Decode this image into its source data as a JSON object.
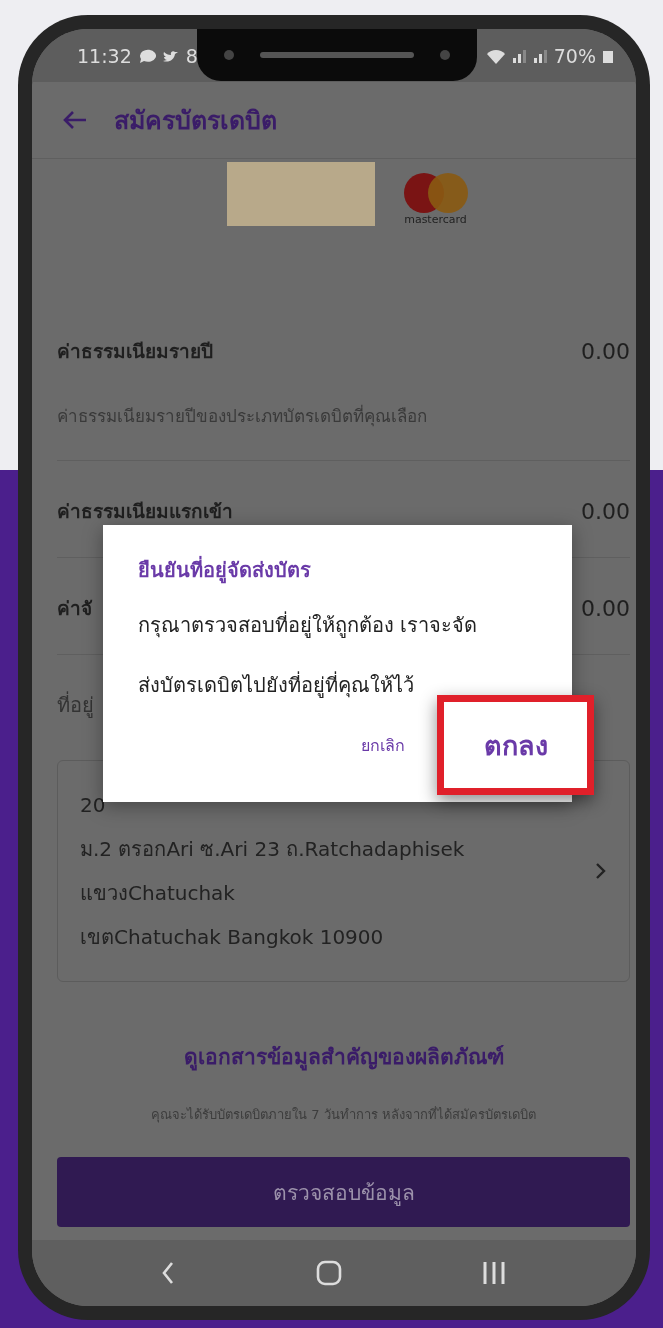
{
  "status_bar": {
    "time": "11:32",
    "notification_count": "8",
    "battery": "70%"
  },
  "header": {
    "title": "สมัครบัตรเดบิต"
  },
  "card_preview": {
    "brand_label": "mastercard"
  },
  "fees": [
    {
      "label": "ค่าธรรมเนียมรายปี",
      "value": "0.00",
      "description": "ค่าธรรมเนียมรายปีของประเภทบัตรเดบิตที่คุณเลือก"
    },
    {
      "label": "ค่าธรรมเนียมแรกเข้า",
      "value": "0.00"
    },
    {
      "label": "ค่าจั",
      "value": "0.00"
    }
  ],
  "address": {
    "label": "ที่อยู่",
    "lines": [
      "20",
      "ม.2 ตรอกAri ซ.Ari 23 ถ.Ratchadaphisek",
      "แขวงChatuchak",
      "เขตChatuchak Bangkok 10900"
    ]
  },
  "document_link": "ดูเอกสารข้อมูลสำคัญของผลิตภัณฑ์",
  "note": "คุณจะได้รับบัตรเดบิตภายใน 7 วันทำการ หลังจากที่ได้สมัครบัตรเดบิต",
  "submit_button": "ตรวจสอบข้อมูล",
  "dialog": {
    "title": "ยืนยันที่อยู่จัดส่งบัตร",
    "message": "กรุณาตรวจสอบที่อยู่ให้ถูกต้อง เราจะจัดส่งบัตรเดบิตไปยังที่อยู่ที่คุณให้ไว้",
    "buttons": [
      {
        "label": "ยกเลิก",
        "highlighted": false
      },
      {
        "label": "ตกลง",
        "highlighted": true
      }
    ]
  }
}
